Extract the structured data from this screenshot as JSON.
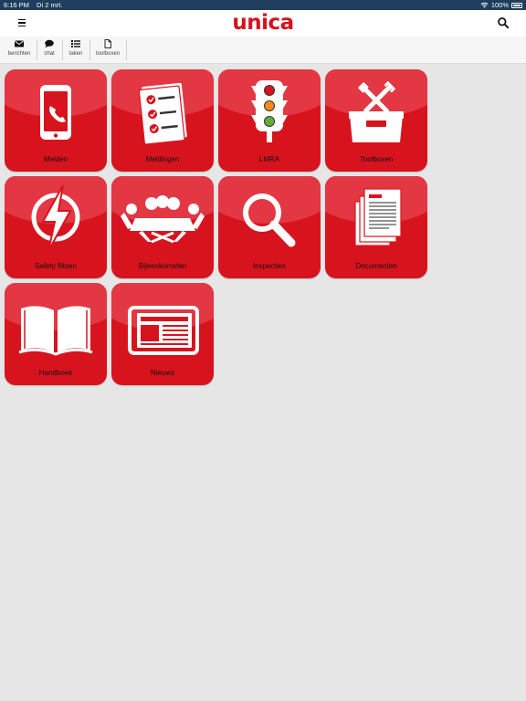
{
  "status_bar": {
    "time": "6:16 PM",
    "date": "Di 2 mrt.",
    "battery": "100%"
  },
  "header": {
    "logo": "unica"
  },
  "toolbar": [
    {
      "label": "berichten",
      "icon": "envelope-icon"
    },
    {
      "label": "chat",
      "icon": "speech-bubble-icon"
    },
    {
      "label": "taken",
      "icon": "list-icon"
    },
    {
      "label": "toolboxen",
      "icon": "document-icon"
    }
  ],
  "tiles": [
    {
      "label": "Melden",
      "icon": "phone-icon"
    },
    {
      "label": "Meldingen",
      "icon": "checklist-icon"
    },
    {
      "label": "LMRA",
      "icon": "traffic-light-icon"
    },
    {
      "label": "Toolboxen",
      "icon": "toolbox-icon"
    },
    {
      "label": "Safety flitsen",
      "icon": "lightning-icon"
    },
    {
      "label": "Bijeenkomsten",
      "icon": "meeting-table-icon"
    },
    {
      "label": "Inspecties",
      "icon": "magnifier-icon"
    },
    {
      "label": "Documenten",
      "icon": "documents-icon"
    },
    {
      "label": "Handboek",
      "icon": "book-icon"
    },
    {
      "label": "Nieuws",
      "icon": "newspaper-icon"
    }
  ],
  "colors": {
    "brand_red": "#d7141e",
    "status_bar": "#1f3d5c",
    "background": "#e6e6e6"
  }
}
